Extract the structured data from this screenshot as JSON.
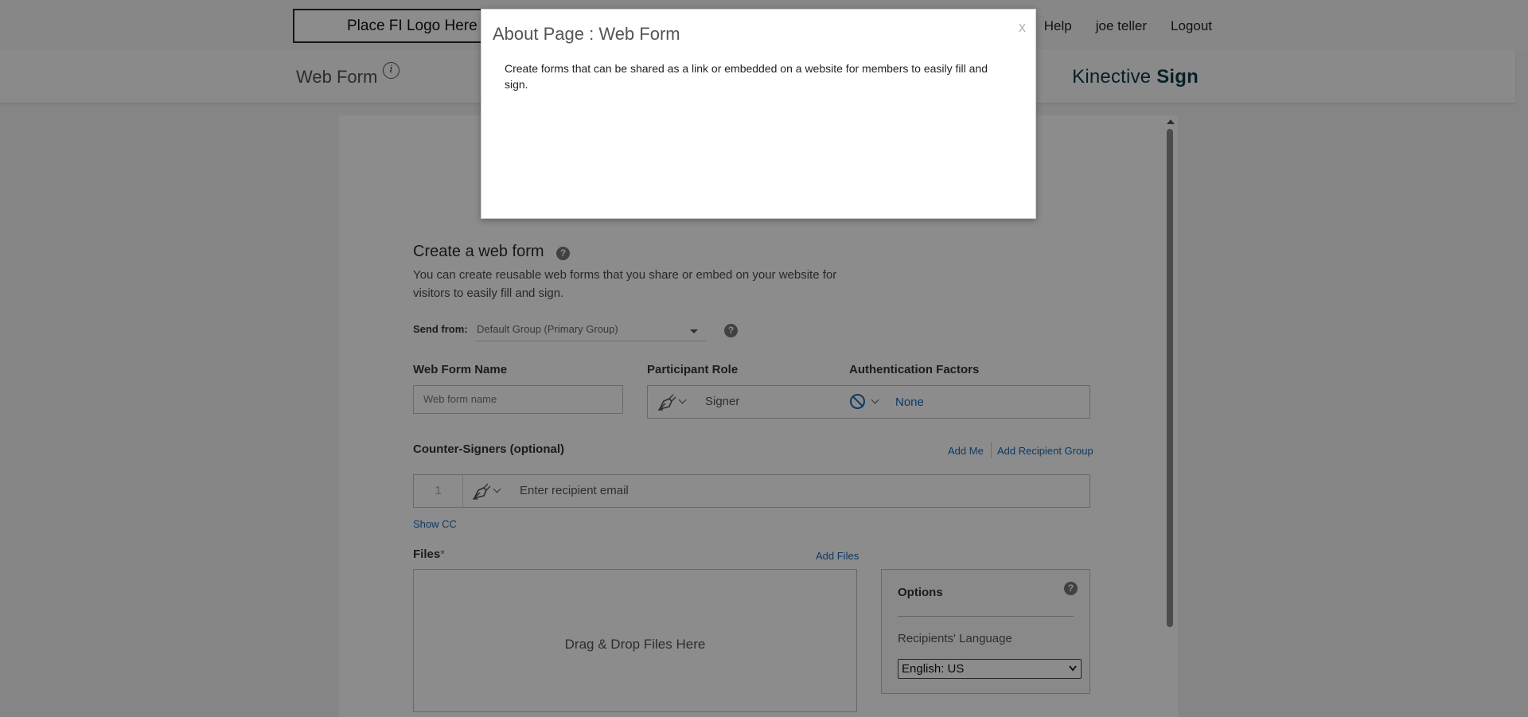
{
  "header": {
    "logo_text": "Place FI Logo Here",
    "nav": [
      "Help",
      "joe teller",
      "Logout"
    ]
  },
  "subheader": {
    "title": "Web Form",
    "info_icon": "i",
    "brand_regular": "Kinective ",
    "brand_bold": "Sign"
  },
  "form": {
    "title": "Create a web form",
    "description": "You can create reusable web forms that you share or embed on your website for visitors to easily fill and sign.",
    "help_glyph": "?",
    "send_from_label": "Send from:",
    "send_from_value": "Default Group (Primary Group)",
    "web_form_name_label": "Web Form Name",
    "web_form_name_placeholder": "Web form name",
    "participant_role_label": "Participant Role",
    "participant_role_value": "Signer",
    "auth_factors_label": "Authentication Factors",
    "auth_factors_value": "None",
    "counter_signers_label": "Counter-Signers (optional)",
    "add_me": "Add Me",
    "add_recipient_group": "Add Recipient Group",
    "recipient_number": "1",
    "recipient_placeholder": "Enter recipient email",
    "show_cc": "Show CC",
    "files_label": "Files",
    "files_required": "*",
    "add_files": "Add Files",
    "drop_text": "Drag & Drop Files Here",
    "options_title": "Options",
    "recipients_language_label": "Recipients' Language",
    "recipients_language_value": "English: US"
  },
  "modal": {
    "title": "About Page : Web Form",
    "close": "x",
    "body": "Create forms that can be shared as a link or embedded on a website for members to easily fill and sign."
  },
  "colors": {
    "link": "#1a6bb5",
    "brand": "#0d3a4a",
    "overlay": "rgba(0,0,0,0.45)"
  }
}
